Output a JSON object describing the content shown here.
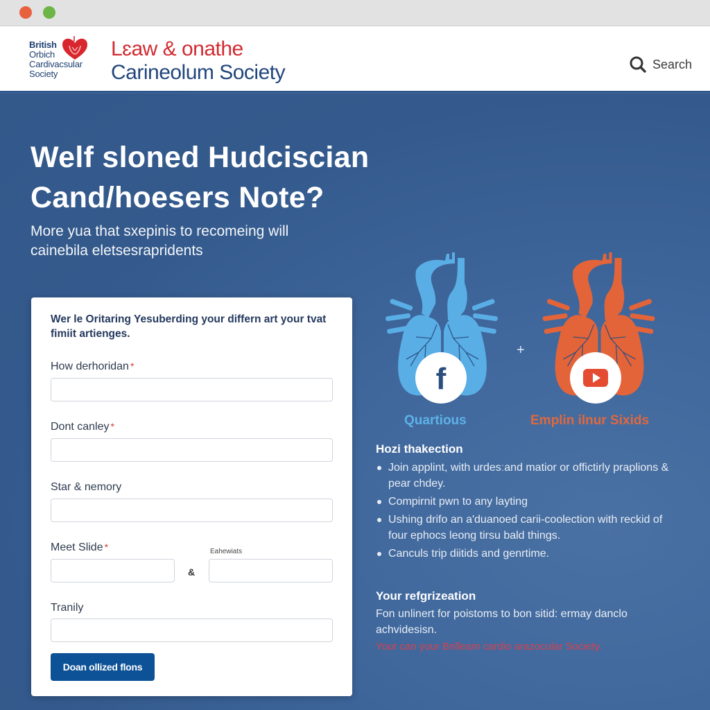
{
  "window": {
    "controls": [
      "close",
      "maximize"
    ]
  },
  "header": {
    "logo": {
      "lines": [
        "British",
        "Orbich",
        "Cardivacsular",
        "Society"
      ],
      "icon": "heart-icon"
    },
    "brand_line1": "Lɛaw & onathe",
    "brand_line2": "Carineolum Society",
    "search_label": "Search",
    "search_icon": "search-icon"
  },
  "hero": {
    "title_line1": "Welf sloned Hudciscian",
    "title_line2": "Cand/hoesers Note?",
    "subtitle_line1": "More yua that sxepinis to recomeing will",
    "subtitle_line2": "cainebila eletsesrapridents"
  },
  "form": {
    "intro": "Wer le Oritaring Yesuberding your differn art your tvat fimiit artienges.",
    "fields": [
      {
        "label": "How derhoridan",
        "required": true,
        "value": ""
      },
      {
        "label": "Dont canley",
        "required": true,
        "value": ""
      },
      {
        "label": "Star & nemory",
        "required": false,
        "value": ""
      },
      {
        "label": "Meet Slide",
        "required": true,
        "value": ""
      },
      {
        "label": "Tranily",
        "required": false,
        "value": ""
      }
    ],
    "secondary_label": "Eahewiats",
    "secondary_value": "",
    "ampersand": "&",
    "required_marker": "*",
    "submit_label": "Doan ollized flons"
  },
  "social": {
    "plus": "+",
    "items": [
      {
        "caption": "Quartious",
        "icon": "facebook-icon",
        "color": "#5eb2e8"
      },
      {
        "caption": "Emplin ilnur Sixids",
        "icon": "youtube-icon",
        "color": "#e0683e"
      }
    ]
  },
  "info": {
    "heading": "Hozi thakection",
    "bullets": [
      "Join applint, with urdesːand matior or offictirly praplions & pear chdey.",
      "Compirnit pwn to any layting",
      "Ushing drifo an a'duanoed carii-coolection with reckid of four ephocs leong tirsu bald things.",
      "Canculs trip diitids and genrtime."
    ]
  },
  "registration": {
    "heading": "Your refgrizeation",
    "text": "Fon unlinert for poistoms to bon sitid: ermay danclo achvidesisn.",
    "link": "Your can your Brilleam cardio arazocular Society."
  }
}
